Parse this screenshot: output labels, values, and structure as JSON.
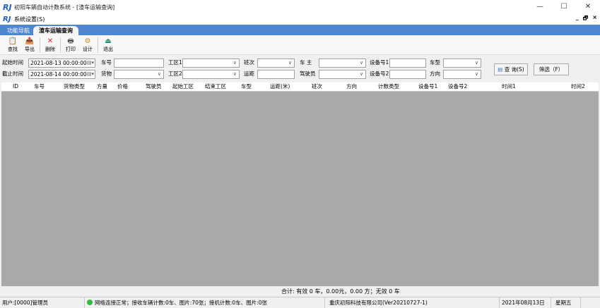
{
  "window": {
    "logo": "RJ",
    "title": "初阳车辆自动计数系统 - [渣车运输查询]",
    "min": "—",
    "max": "☐",
    "close": "✕"
  },
  "menubar": {
    "settings": "系统设置(S)",
    "mdi_min": "_",
    "mdi_restore": "🗗",
    "mdi_close": "×"
  },
  "tabs": {
    "nav": "功能导航",
    "active": "渣车运输查询"
  },
  "toolbar": [
    {
      "icon": "search-icon",
      "glyph": "📋",
      "label": "查找"
    },
    {
      "icon": "export-icon",
      "glyph": "📤",
      "label": "导出"
    },
    {
      "icon": "delete-icon",
      "glyph": "✕",
      "label": "删除"
    },
    {
      "icon": "print-icon",
      "glyph": "🖶",
      "label": "打印"
    },
    {
      "icon": "design-icon",
      "glyph": "⚙",
      "label": "设计"
    },
    {
      "icon": "exit-icon",
      "glyph": "⏏",
      "label": "退出"
    }
  ],
  "filters": {
    "start_label": "起始时间",
    "start_value": "2021-08-13 00:00:00",
    "end_label": "截止时间",
    "end_value": "2021-08-14 00:00:00",
    "plate_label": "车号",
    "goods_label": "货物",
    "zone1_label": "工区1",
    "zone2_label": "工区2",
    "shift_label": "班次",
    "distance_label": "运距",
    "owner_label": "车 主",
    "driver_label": "驾驶员",
    "device1_label": "设备号1",
    "device2_label": "设备号2",
    "cartype_label": "车型",
    "direction_label": "方向",
    "query_button": "查 询(S)",
    "filter_button": "筛选（F）"
  },
  "columns": [
    "ID",
    "车号",
    "货物类型",
    "方量",
    "价格",
    "驾驶员",
    "起始工区",
    "结束工区",
    "车型",
    "运距(米)",
    "班次",
    "方向",
    "计数类型",
    "设备号1",
    "设备号2",
    "时间1",
    "时间2"
  ],
  "summary": "合计: 有效 0 车，0.00元，0.00 方；无效 0 车",
  "status": {
    "user": "用户:[0000]管理员",
    "network": "网络连接正常；接收车辆计数:0车、图片:70张；接机计数:0车、图片:0张",
    "company": "重庆初阳科技有限公司(Ver20210727-1)",
    "date": "2021年08月13日",
    "weekday": "星期五"
  }
}
